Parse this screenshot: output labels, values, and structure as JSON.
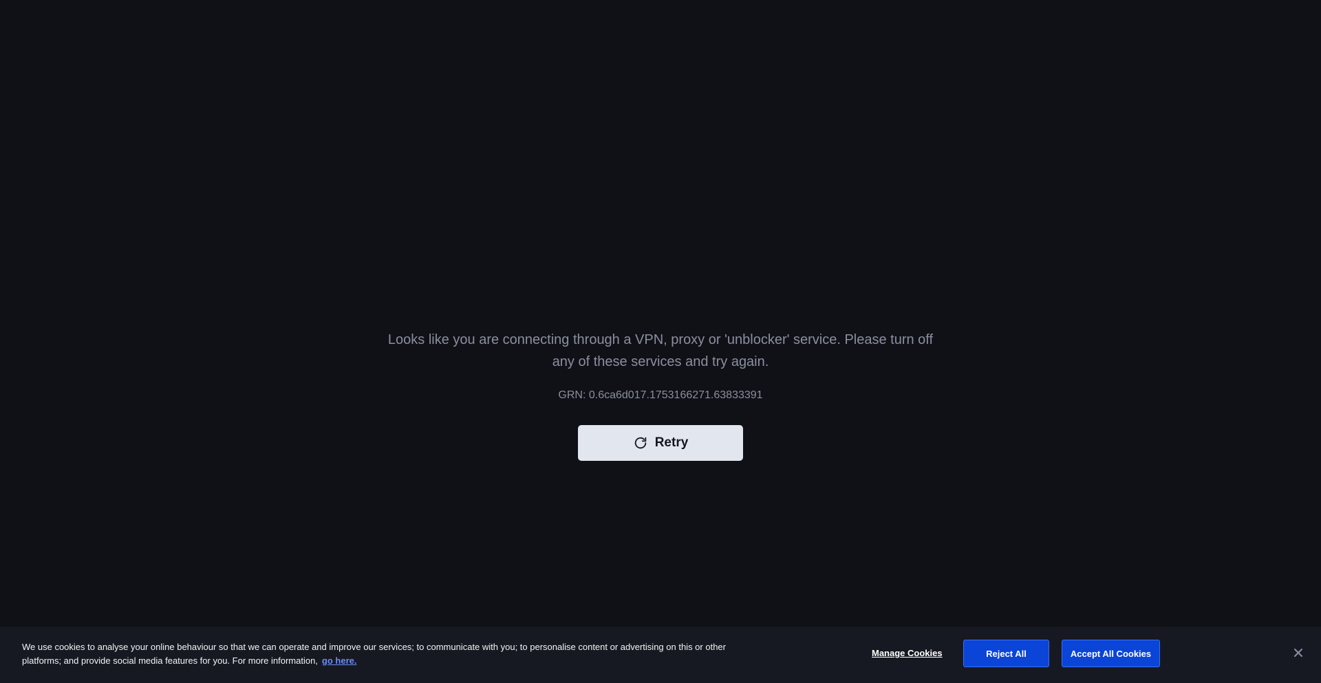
{
  "error": {
    "message": "Looks like you are connecting through a VPN, proxy or 'unblocker' service. Please turn off any of these services and try again.",
    "grn": "GRN: 0.6ca6d017.1753166271.63833391",
    "retry_label": "Retry",
    "retry_icon": "refresh-icon"
  },
  "cookie_banner": {
    "text": "We use cookies to analyse your online behaviour so that we can operate and improve our services; to communicate with you; to personalise content or advertising on this or other platforms; and provide social media features for you. For more information,",
    "link_label": "go here.",
    "manage_label": "Manage Cookies",
    "reject_label": "Reject All",
    "accept_label": "Accept All Cookies",
    "close_icon": "close-icon"
  },
  "colors": {
    "background": "#101116",
    "banner_background": "#171922",
    "button_blue": "#0a45d8",
    "retry_button": "#e2e6ee",
    "muted_text": "#8a8fa1",
    "link": "#6b8cff"
  }
}
